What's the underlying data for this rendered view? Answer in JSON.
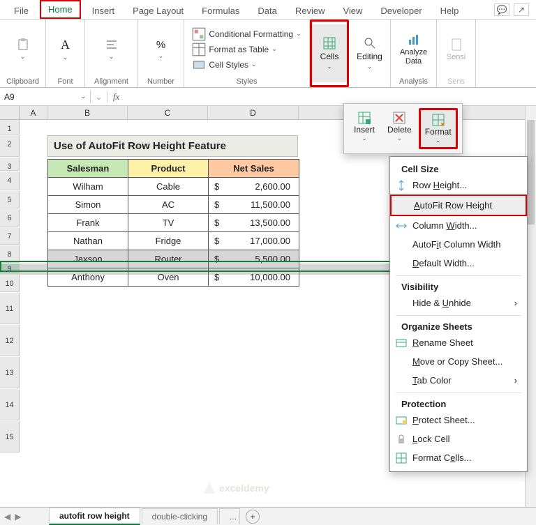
{
  "tabs": [
    "File",
    "Home",
    "Insert",
    "Page Layout",
    "Formulas",
    "Data",
    "Review",
    "View",
    "Developer",
    "Help"
  ],
  "ribbon": {
    "clipboard": "Clipboard",
    "font": "Font",
    "alignment": "Alignment",
    "number": "Number",
    "styles_label": "Styles",
    "cond_fmt": "Conditional Formatting",
    "fmt_table": "Format as Table",
    "cell_styles": "Cell Styles",
    "cells": "Cells",
    "editing": "Editing",
    "analyze": "Analyze Data",
    "analysis_label": "Analysis",
    "sens": "Sensi",
    "sens_label": "Sens"
  },
  "namebox": "A9",
  "fx_label": "fx",
  "cells_panel": {
    "insert": "Insert",
    "delete": "Delete",
    "format": "Format"
  },
  "format_menu": {
    "cell_size": "Cell Size",
    "row_height": "Row Height...",
    "autofit_row": "AutoFit Row Height",
    "col_width": "Column Width...",
    "autofit_col": "AutoFit Column Width",
    "default_width": "Default Width...",
    "visibility": "Visibility",
    "hide_unhide": "Hide & Unhide",
    "organize": "Organize Sheets",
    "rename": "Rename Sheet",
    "move_copy": "Move or Copy Sheet...",
    "tab_color": "Tab Color",
    "protection": "Protection",
    "protect": "Protect Sheet...",
    "lock": "Lock Cell",
    "format_cells": "Format Cells..."
  },
  "title": "Use of AutoFit Row Height Feature",
  "headers": {
    "salesman": "Salesman",
    "product": "Product",
    "net": "Net Sales"
  },
  "rows": [
    {
      "s": "Wilham",
      "p": "Cable",
      "c": "$",
      "v": "2,600.00"
    },
    {
      "s": "Simon",
      "p": "AC",
      "c": "$",
      "v": "11,500.00"
    },
    {
      "s": "Frank",
      "p": "TV",
      "c": "$",
      "v": "13,500.00"
    },
    {
      "s": "Nathan",
      "p": "Fridge",
      "c": "$",
      "v": "17,000.00"
    },
    {
      "s": "Jaxson",
      "p": "Router",
      "c": "$",
      "v": "5,500.00"
    },
    {
      "s": "Anthony",
      "p": "Oven",
      "c": "$",
      "v": "10,000.00"
    }
  ],
  "colhdrs": [
    "A",
    "B",
    "C",
    "D"
  ],
  "rowhdrs": [
    "1",
    "2",
    "3",
    "4",
    "5",
    "6",
    "7",
    "8",
    "9",
    "10",
    "11",
    "12",
    "13",
    "14",
    "15"
  ],
  "sheet_tabs": {
    "active": "autofit row height",
    "other": "double-clicking",
    "more": "..."
  },
  "watermark": "exceldemy"
}
